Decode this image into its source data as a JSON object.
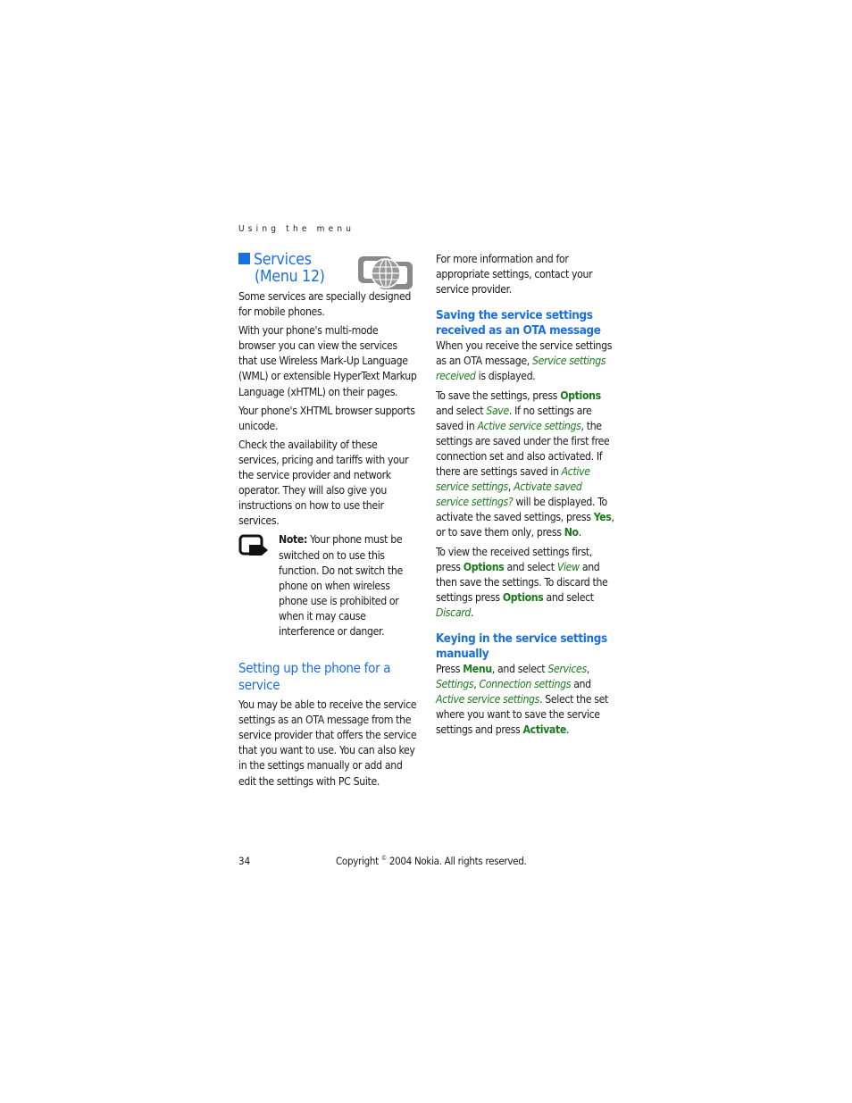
{
  "running_head": "Using the menu",
  "section": {
    "title_line1": "Services",
    "title_line2": "(Menu 12)",
    "icon": "globe-services-icon"
  },
  "left": {
    "p1": "Some services are specially designed for mobile phones.",
    "p2": "With your phone's multi-mode browser you can view the services that use Wireless Mark-Up Language (WML) or extensible HyperText Markup Language (xHTML) on their pages.",
    "p3": "Your phone's XHTML browser supports unicode.",
    "p4": "Check the availability of these services, pricing and tariffs with your the service provider and network operator. They will also give you instructions on how to use their services.",
    "note": {
      "label": "Note:",
      "text": " Your phone must be switched on to use this function. Do not switch the phone on when wireless phone use is prohibited or when it may cause interference or danger."
    },
    "h_setup": "Setting up the phone for a service",
    "p5": "You may be able to receive the service settings as an OTA message from the service provider that offers the service that you want to use. You can also key in the settings manually or add and edit the settings with PC Suite."
  },
  "right": {
    "p1": "For more information and for appropriate settings, contact your service provider.",
    "h_saving": "Saving the service settings received as an OTA message",
    "p2": {
      "a": "When you receive the service settings as an OTA message, ",
      "b": "Service settings received",
      "c": " is displayed."
    },
    "p3": {
      "a": "To save the settings, press ",
      "b": "Options",
      "c": " and select ",
      "d": "Save",
      "e": ". If no settings are saved in ",
      "f": "Active service settings",
      "g": ", the settings are saved under the first free connection set and also activated. If there are settings saved in ",
      "h": "Active service settings",
      "i": ", ",
      "j": "Activate saved service settings?",
      "k": " will be displayed. To activate the saved settings, press ",
      "l": "Yes",
      "m": ", or to save them only, press ",
      "n": "No",
      "o": "."
    },
    "p4": {
      "a": "To view the received settings first, press ",
      "b": "Options",
      "c": " and select ",
      "d": "View",
      "e": " and then save the settings. To discard the settings press ",
      "f": "Options",
      "g": " and select ",
      "h": "Discard",
      "i": "."
    },
    "h_keying": "Keying in the service settings manually",
    "p5": {
      "a": "Press ",
      "b": "Menu",
      "c": ", and select ",
      "d": "Services",
      "e": ", ",
      "f": "Settings",
      "g": ", ",
      "h": "Connection settings",
      "i": " and ",
      "j": "Active service settings",
      "k": ". Select the set where you want to save the service settings and press ",
      "l": "Activate",
      "m": "."
    }
  },
  "footer": {
    "page_number": "34",
    "copyright_a": "Copyright ",
    "copyright_sym": "©",
    "copyright_b": " 2004 Nokia. All rights reserved."
  },
  "colors": {
    "heading_blue": "#1a6fe0",
    "keyword_green": "#1a7a1a"
  }
}
